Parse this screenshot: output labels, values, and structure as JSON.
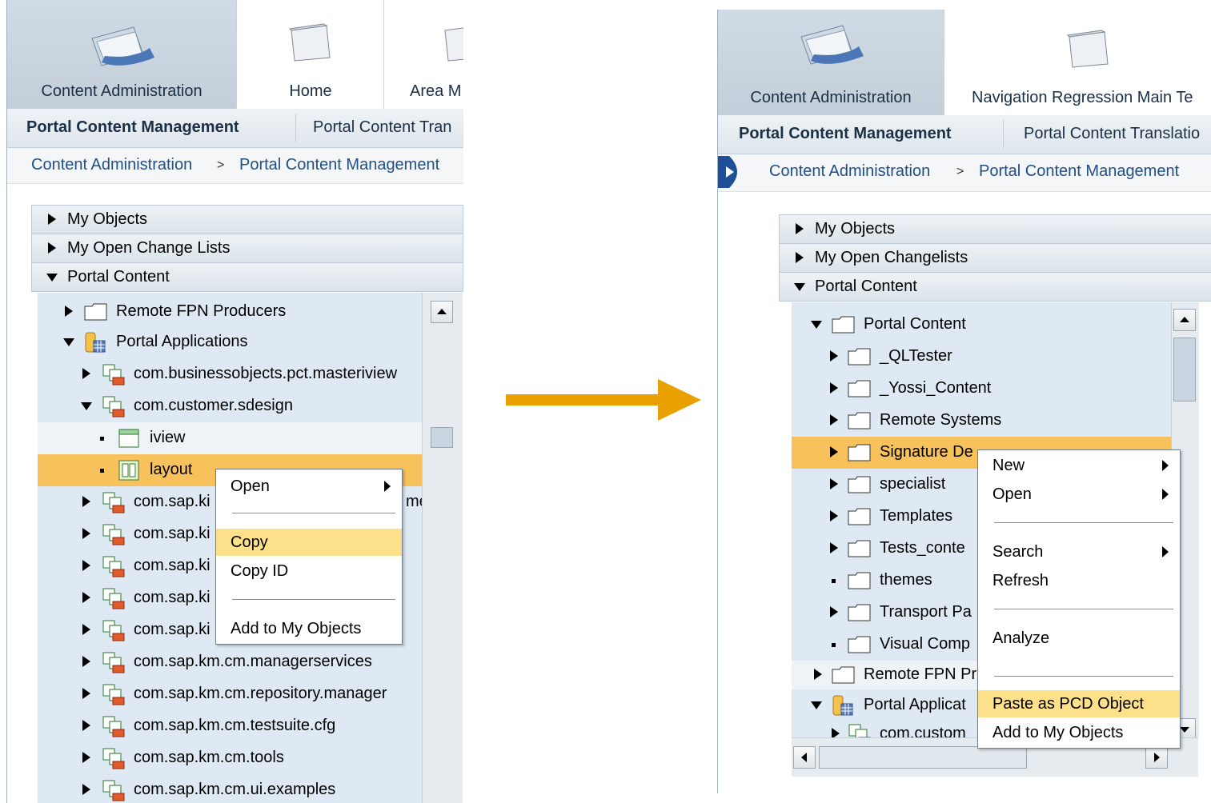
{
  "left": {
    "tabs": [
      "Content Administration",
      "Home",
      "Area M"
    ],
    "nav2": [
      "Portal Content Management",
      "Portal Content Tran"
    ],
    "breadcrumb": {
      "a": "Content Administration",
      "sep": ">",
      "b": "Portal Content Management"
    },
    "sections": [
      "My Objects",
      "My Open Change Lists",
      "Portal Content"
    ],
    "tree": [
      "Remote FPN Producers",
      "Portal Applications",
      "com.businessobjects.pct.masteriview",
      "com.customer.sdesign",
      "iview",
      "layout",
      "com.sap.ki",
      "com.sap.ki",
      "com.sap.ki",
      "com.sap.ki",
      "com.sap.ki",
      "com.sap.km.cm.managerservices",
      "com.sap.km.cm.repository.manager",
      "com.sap.km.cm.testsuite.cfg",
      "com.sap.km.cm.tools",
      "com.sap.km.cm.ui.examples"
    ],
    "tree_trailing": "me",
    "menu": [
      "Open",
      "Copy",
      "Copy ID",
      "Add to My Objects"
    ]
  },
  "right": {
    "tabs": [
      "Content Administration",
      "Navigation Regression Main Te"
    ],
    "nav2": [
      "Portal Content Management",
      "Portal Content Translatio"
    ],
    "breadcrumb": {
      "a": "Content Administration",
      "sep": ">",
      "b": "Portal Content Management"
    },
    "sections": [
      "My Objects",
      "My Open Changelists",
      "Portal Content"
    ],
    "tree": [
      "Portal Content",
      "_QLTester",
      "_Yossi_Content",
      "Remote Systems",
      "Signature De",
      "specialist",
      "Templates",
      "Tests_conte",
      "themes",
      "Transport Pa",
      "Visual Comp",
      "Remote FPN Pr",
      "Portal Applicat",
      "com.custom"
    ],
    "menu": [
      "New",
      "Open",
      "Search",
      "Refresh",
      "Analyze",
      "Paste as PCD Object",
      "Add to My Objects"
    ]
  },
  "colors": {
    "arrow": "#e8a100",
    "selection": "#f7c15b",
    "menu_highlight": "#fce08a"
  }
}
